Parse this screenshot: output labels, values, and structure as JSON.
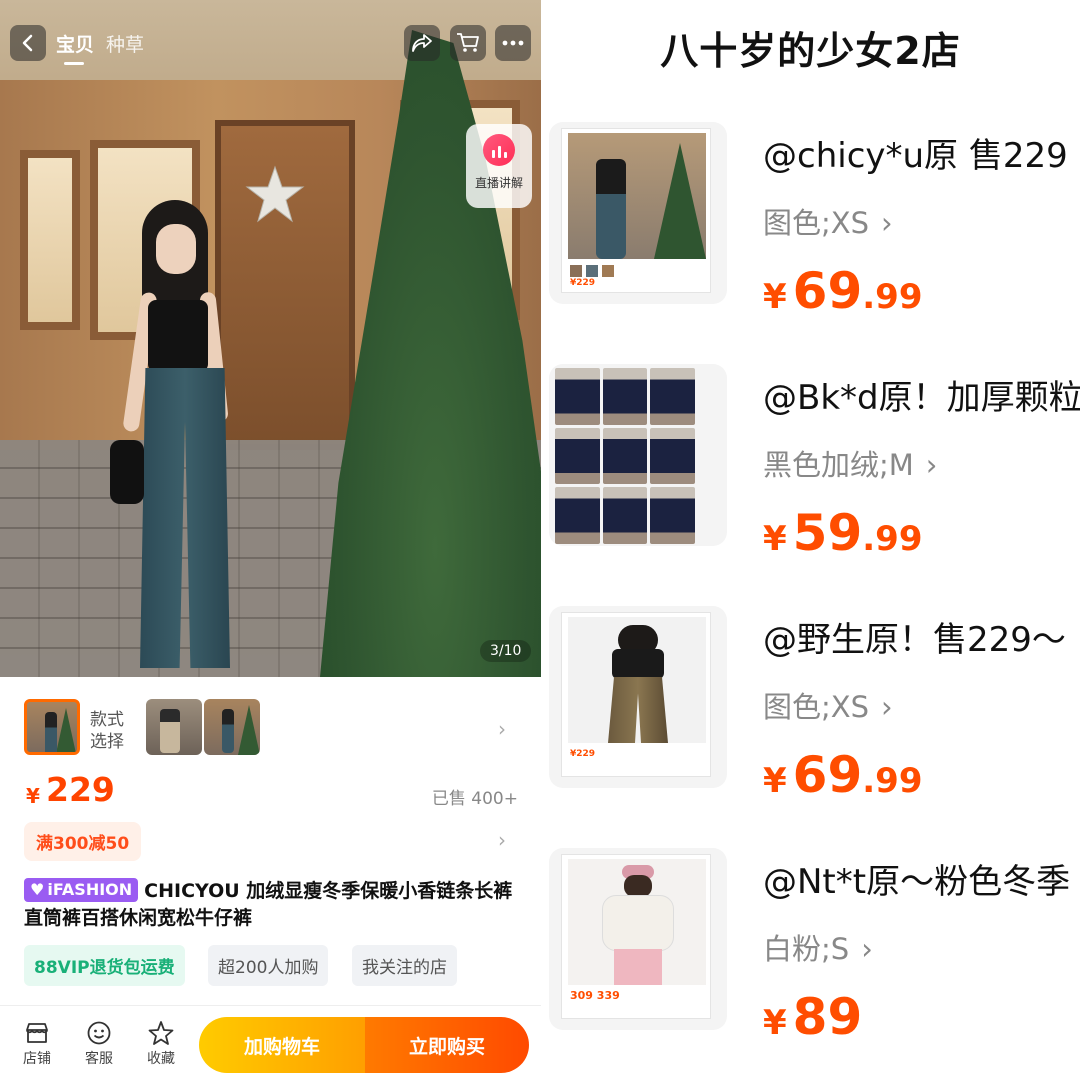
{
  "left": {
    "nav": {
      "tab_item": "宝贝",
      "tab_seed": "种草"
    },
    "live": {
      "label": "直播讲解"
    },
    "gallery": {
      "counter": "3/10"
    },
    "style_select": {
      "label": "款式选择"
    },
    "price": {
      "currency": "¥",
      "value": "229",
      "sold": "已售 400+"
    },
    "promo": "满300减50",
    "title": {
      "badge": "iFASHION",
      "text": "CHICYOU 加绒显瘦冬季保暖小香链条长裤直筒裤百搭休闲宽松牛仔裤"
    },
    "tags": [
      "88VIP退货包运费",
      "超200人加购",
      "我关注的店"
    ],
    "bottom": {
      "store": "店铺",
      "service": "客服",
      "favorite": "收藏",
      "add_cart": "加购物车",
      "buy_now": "立即购买"
    }
  },
  "right": {
    "shop_title": "八十岁的少女2店",
    "items": [
      {
        "name": "@chicy*u原 售229",
        "spec": "图色;XS",
        "price_int": "69",
        "price_dec": ".99",
        "mini_price": "¥229"
      },
      {
        "name": "@Bk*d原！加厚颗粒",
        "spec": "黑色加绒;M",
        "price_int": "59",
        "price_dec": ".99"
      },
      {
        "name": "@野生原！售229～",
        "spec": "图色;XS",
        "price_int": "69",
        "price_dec": ".99",
        "mini_price": "¥229"
      },
      {
        "name": "@Nt*t原～粉色冬季",
        "spec": "白粉;S",
        "price_int": "89",
        "price_dec": "",
        "mini_price": "309 339"
      }
    ],
    "currency": "¥"
  },
  "colors": {
    "accent_orange": "#ff4d00",
    "cart_yellow": "#ffb800",
    "vip_green": "#19b078",
    "ifashion_purple": "#9a5cf2"
  }
}
